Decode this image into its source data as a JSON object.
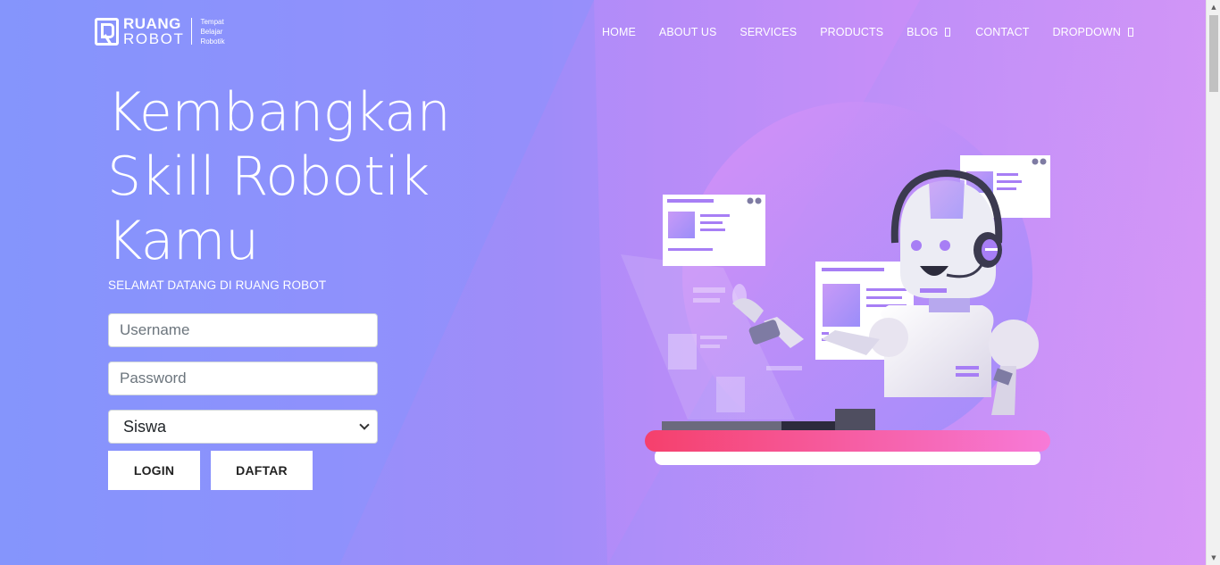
{
  "header": {
    "logo": {
      "word1": "RUANG",
      "word2": "ROBOT",
      "tagline": [
        "Tempat",
        "Belajar",
        "Robotik"
      ]
    },
    "nav": [
      {
        "label": "HOME"
      },
      {
        "label": "ABOUT US"
      },
      {
        "label": "SERVICES"
      },
      {
        "label": "PRODUCTS"
      },
      {
        "label": "BLOG",
        "has_dropdown": true
      },
      {
        "label": "CONTACT"
      },
      {
        "label": "DROPDOWN",
        "has_dropdown": true
      }
    ]
  },
  "hero": {
    "title_lines": [
      "Kembangkan",
      "Skill Robotik",
      "Kamu"
    ],
    "subtitle": "SELAMAT DATANG DI RUANG ROBOT"
  },
  "login_form": {
    "username_placeholder": "Username",
    "password_placeholder": "Password",
    "role_selected": "Siswa",
    "login_label": "LOGIN",
    "register_label": "DAFTAR"
  },
  "colors": {
    "gradient_start": "#8795fb",
    "gradient_end": "#de98f6",
    "desk_accent": "#f5406c",
    "desk_accent_end": "#f77ad8"
  },
  "icons": {
    "nav_dropdown": "chevron-down-icon",
    "select_arrow": "chevron-down-icon",
    "illustration": "robot-with-headset-illustration"
  }
}
